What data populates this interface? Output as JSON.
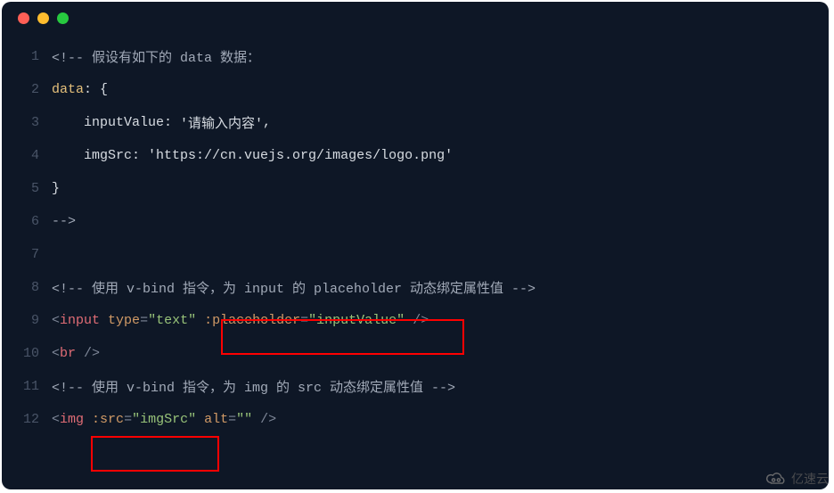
{
  "lines": [
    {
      "n": "1",
      "segments": [
        {
          "t": "<!-- 假设有如下的 data 数据：",
          "cls": "c-comment"
        }
      ]
    },
    {
      "n": "2",
      "segments": [
        {
          "t": "data",
          "cls": "c-yellow"
        },
        {
          "t": ": {",
          "cls": "c-white"
        }
      ]
    },
    {
      "n": "3",
      "segments": [
        {
          "t": "    inputValue: ",
          "cls": "c-white"
        },
        {
          "t": "'请输入内容'",
          "cls": "c-white"
        },
        {
          "t": ",",
          "cls": "c-white"
        }
      ]
    },
    {
      "n": "4",
      "segments": [
        {
          "t": "    imgSrc: ",
          "cls": "c-white"
        },
        {
          "t": "'https://cn.vuejs.org/images/logo.png'",
          "cls": "c-white"
        }
      ]
    },
    {
      "n": "5",
      "segments": [
        {
          "t": "}",
          "cls": "c-white"
        }
      ]
    },
    {
      "n": "6",
      "segments": [
        {
          "t": "-->",
          "cls": "c-comment"
        }
      ]
    },
    {
      "n": "7",
      "segments": [
        {
          "t": "",
          "cls": ""
        }
      ]
    },
    {
      "n": "8",
      "segments": [
        {
          "t": "<!-- 使用 v-bind 指令，为 input 的 placeholder 动态绑定属性值 -->",
          "cls": "c-comment"
        }
      ]
    },
    {
      "n": "9",
      "segments": [
        {
          "t": "<",
          "cls": "c-punct"
        },
        {
          "t": "input",
          "cls": "c-tag"
        },
        {
          "t": " ",
          "cls": ""
        },
        {
          "t": "type",
          "cls": "c-attr"
        },
        {
          "t": "=",
          "cls": "c-punct"
        },
        {
          "t": "\"text\"",
          "cls": "c-val"
        },
        {
          "t": " ",
          "cls": ""
        },
        {
          "t": ":placeholder",
          "cls": "c-attr"
        },
        {
          "t": "=",
          "cls": "c-punct"
        },
        {
          "t": "\"inputValue\"",
          "cls": "c-val"
        },
        {
          "t": " />",
          "cls": "c-punct"
        }
      ]
    },
    {
      "n": "10",
      "segments": [
        {
          "t": "<",
          "cls": "c-punct"
        },
        {
          "t": "br",
          "cls": "c-tag"
        },
        {
          "t": " />",
          "cls": "c-punct"
        }
      ]
    },
    {
      "n": "11",
      "segments": [
        {
          "t": "<!-- 使用 v-bind 指令，为 img 的 src 动态绑定属性值 -->",
          "cls": "c-comment"
        }
      ]
    },
    {
      "n": "12",
      "segments": [
        {
          "t": "<",
          "cls": "c-punct"
        },
        {
          "t": "img",
          "cls": "c-tag"
        },
        {
          "t": " ",
          "cls": ""
        },
        {
          "t": ":src",
          "cls": "c-attr"
        },
        {
          "t": "=",
          "cls": "c-punct"
        },
        {
          "t": "\"imgSrc\"",
          "cls": "c-val"
        },
        {
          "t": " ",
          "cls": ""
        },
        {
          "t": "alt",
          "cls": "c-attr"
        },
        {
          "t": "=",
          "cls": "c-punct"
        },
        {
          "t": "\"\"",
          "cls": "c-val"
        },
        {
          "t": " />",
          "cls": "c-punct"
        }
      ]
    }
  ],
  "watermark": {
    "text": "亿速云"
  }
}
